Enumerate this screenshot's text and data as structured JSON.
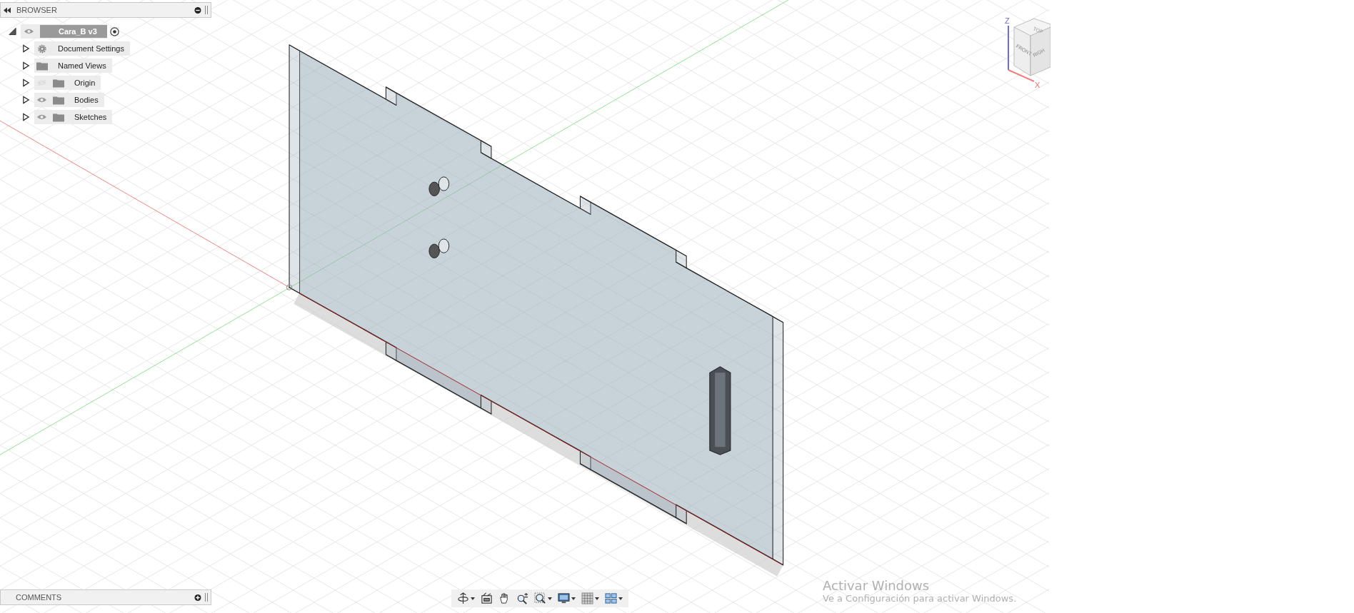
{
  "browser": {
    "title": "BROWSER",
    "root": {
      "label": "Cara_B v3",
      "expanded": true,
      "visible": true
    },
    "items": [
      {
        "label": "Document Settings",
        "kind": "settings",
        "expanded": false
      },
      {
        "label": "Named Views",
        "kind": "views",
        "expanded": false
      },
      {
        "label": "Origin",
        "kind": "folder",
        "expanded": false,
        "visible": false
      },
      {
        "label": "Bodies",
        "kind": "folder",
        "expanded": false,
        "visible": true
      },
      {
        "label": "Sketches",
        "kind": "folder",
        "expanded": false,
        "visible": true
      }
    ]
  },
  "view_cube": {
    "faces": [
      {
        "kind": "top",
        "label": "TOP"
      },
      {
        "kind": "front",
        "label": "FRONT"
      },
      {
        "kind": "right",
        "label": "RIGH"
      }
    ],
    "axes": [
      {
        "kind": "z",
        "label": "Z"
      },
      {
        "kind": "x",
        "label": "X"
      }
    ]
  },
  "comments": {
    "title": "COMMENTS"
  },
  "navigation_bar": [
    {
      "kind": "orbit",
      "dropdown": true
    },
    {
      "kind": "look-at",
      "dropdown": false
    },
    {
      "kind": "pan",
      "dropdown": false
    },
    {
      "kind": "zoom",
      "dropdown": false
    },
    {
      "kind": "fit",
      "dropdown": true
    },
    {
      "kind": "display",
      "dropdown": true
    },
    {
      "kind": "grid",
      "dropdown": true
    },
    {
      "kind": "viewports",
      "dropdown": true
    }
  ],
  "activation_notice": {
    "title": "Activar Windows",
    "message": "Ve a Configuración para activar Windows."
  }
}
